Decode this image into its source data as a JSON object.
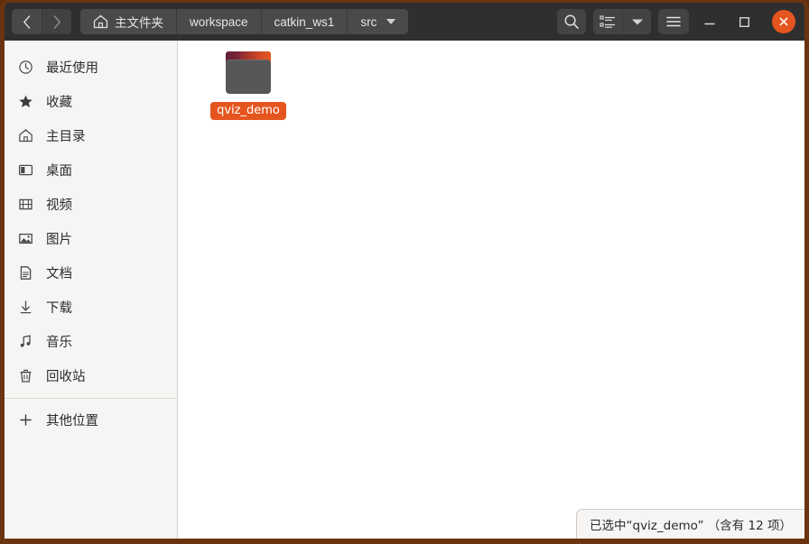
{
  "window": {
    "frame_color": "#6b3410",
    "header_bg": "#2f2f2f",
    "accent_color": "#e5551f"
  },
  "header": {
    "nav": {
      "back_label": "‹",
      "back_icon": "chevron-left-icon",
      "forward_label": "›",
      "forward_icon": "chevron-right-icon"
    },
    "breadcrumbs": [
      {
        "label": "主文件夹",
        "icon": "home-icon",
        "has_caret": false
      },
      {
        "label": "workspace",
        "icon": "",
        "has_caret": false
      },
      {
        "label": "catkin_ws1",
        "icon": "",
        "has_caret": false
      },
      {
        "label": "src",
        "icon": "",
        "has_caret": true
      }
    ],
    "buttons": {
      "search_icon": "search-icon",
      "view_list_icon": "list-view-icon",
      "view_dropdown_icon": "chevron-down-icon",
      "menu_icon": "hamburger-menu-icon"
    },
    "window_controls": {
      "minimize_label": "–",
      "minimize_icon": "minimize-icon",
      "maximize_label": "□",
      "maximize_icon": "maximize-icon",
      "close_label": "×",
      "close_icon": "close-icon"
    }
  },
  "sidebar": {
    "items": [
      {
        "label": "最近使用",
        "icon": "clock-recent-icon"
      },
      {
        "label": "收藏",
        "icon": "star-icon"
      },
      {
        "label": "主目录",
        "icon": "home-icon"
      },
      {
        "label": "桌面",
        "icon": "desktop-icon"
      },
      {
        "label": "视频",
        "icon": "film-icon"
      },
      {
        "label": "图片",
        "icon": "image-icon"
      },
      {
        "label": "文档",
        "icon": "document-icon"
      },
      {
        "label": "下载",
        "icon": "download-icon"
      },
      {
        "label": "音乐",
        "icon": "music-note-icon"
      },
      {
        "label": "回收站",
        "icon": "trash-icon"
      }
    ],
    "other_locations": {
      "label": "其他位置",
      "icon": "plus-icon"
    }
  },
  "files": [
    {
      "name": "qviz_demo",
      "icon": "folder-icon",
      "selected": true
    }
  ],
  "status": {
    "text": "已选中“qviz_demo” （含有 12 项）"
  }
}
